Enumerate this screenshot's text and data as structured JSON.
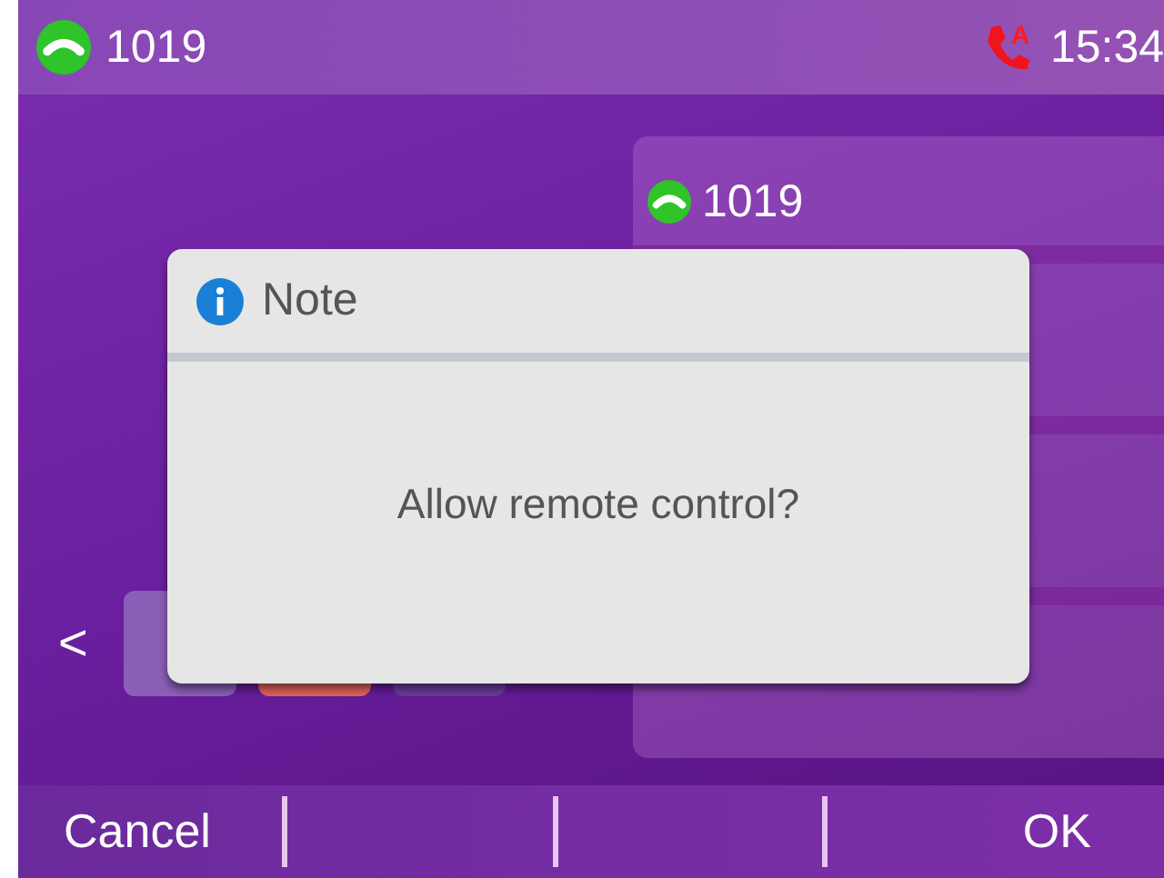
{
  "status_bar": {
    "account": "1019",
    "missed_call_indicator": true,
    "missed_call_badge": "A",
    "time": "15:34"
  },
  "idle_screen": {
    "back": "<",
    "line_keys": [
      {
        "label": "1019",
        "registered": true
      }
    ]
  },
  "dialog": {
    "title": "Note",
    "message": "Allow remote control?"
  },
  "softkeys": [
    {
      "label": "Cancel"
    },
    {
      "label": "OK"
    }
  ]
}
